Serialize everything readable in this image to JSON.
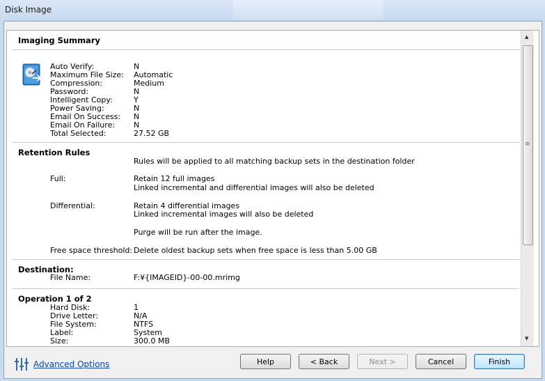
{
  "window": {
    "title": "Disk Image"
  },
  "summary": {
    "title": "Imaging Summary",
    "rows": [
      {
        "label": "Auto Verify:",
        "value": "N"
      },
      {
        "label": "Maximum File Size:",
        "value": "Automatic"
      },
      {
        "label": "Compression:",
        "value": "Medium"
      },
      {
        "label": "Password:",
        "value": "N"
      },
      {
        "label": "Intelligent Copy:",
        "value": "Y"
      },
      {
        "label": "Power Saving:",
        "value": "N"
      },
      {
        "label": "Email On Success:",
        "value": "N"
      },
      {
        "label": "Email On Failure:",
        "value": "N"
      },
      {
        "label": "Total Selected:",
        "value": "27.52 GB"
      }
    ]
  },
  "retention": {
    "title": "Retention Rules",
    "intro": "Rules will be applied to all matching backup sets in the destination folder",
    "full_label": "Full:",
    "full_line1": "Retain 12 full images",
    "full_line2": "Linked incremental and differential images will also be deleted",
    "diff_label": "Differential:",
    "diff_line1": "Retain 4 differential images",
    "diff_line2": "Linked incremental images will also be deleted",
    "purge": "Purge will be run after the image.",
    "threshold_label": "Free space threshold:",
    "threshold_value": "Delete oldest backup sets when free space is less than 5.00 GB"
  },
  "destination": {
    "title": "Destination:",
    "file_label": "File Name:",
    "file_value": "F:¥{IMAGEID}-00-00.mrimg"
  },
  "operation": {
    "title": "Operation 1 of 2",
    "rows": [
      {
        "label": "Hard Disk:",
        "value": "1"
      },
      {
        "label": "Drive Letter:",
        "value": "N/A"
      },
      {
        "label": "File System:",
        "value": "NTFS"
      },
      {
        "label": "Label:",
        "value": "System"
      },
      {
        "label": "Size:",
        "value": "300.0 MB"
      }
    ]
  },
  "footer": {
    "advanced": "Advanced Options",
    "help": "Help",
    "back": "< Back",
    "next": "Next >",
    "cancel": "Cancel",
    "finish": "Finish"
  },
  "icons": {
    "disk": "hard-disk-icon",
    "advanced": "sliders-icon",
    "scroll_up": "scroll-up-arrow-icon",
    "scroll_down": "scroll-down-arrow-icon"
  }
}
